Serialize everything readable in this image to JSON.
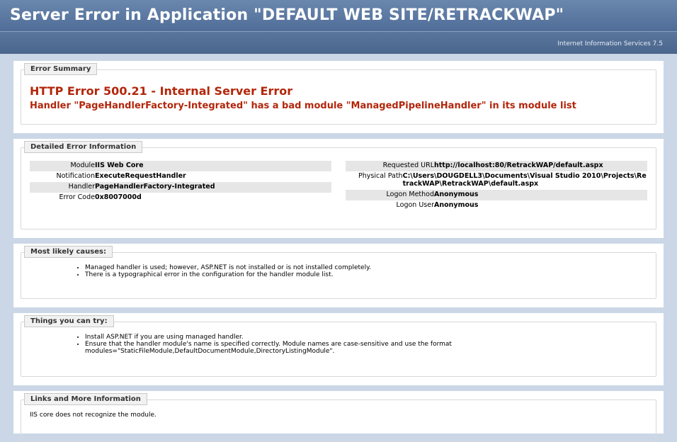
{
  "header": {
    "title": "Server Error in Application \"DEFAULT WEB SITE/RETRACKWAP\"",
    "server_name": "Internet Information Services 7.5"
  },
  "summary": {
    "legend": "Error Summary",
    "title": "HTTP Error 500.21 - Internal Server Error",
    "subtitle": "Handler \"PageHandlerFactory-Integrated\" has a bad module \"ManagedPipelineHandler\" in its module list"
  },
  "details": {
    "legend": "Detailed Error Information",
    "left": [
      {
        "label": "Module",
        "value": "IIS Web Core"
      },
      {
        "label": "Notification",
        "value": "ExecuteRequestHandler"
      },
      {
        "label": "Handler",
        "value": "PageHandlerFactory-Integrated"
      },
      {
        "label": "Error Code",
        "value": "0x8007000d"
      }
    ],
    "right": [
      {
        "label": "Requested URL",
        "value": "http://localhost:80/RetrackWAP/default.aspx"
      },
      {
        "label": "Physical Path",
        "value": "C:\\Users\\DOUGDELL3\\Documents\\Visual Studio 2010\\Projects\\RetrackWAP\\RetrackWAP\\default.aspx"
      },
      {
        "label": "Logon Method",
        "value": "Anonymous"
      },
      {
        "label": "Logon User",
        "value": "Anonymous"
      }
    ]
  },
  "causes": {
    "legend": "Most likely causes:",
    "items": [
      "Managed handler is used; however, ASP.NET is not installed or is not installed completely.",
      "There is a typographical error in the configuration for the handler module list."
    ]
  },
  "try": {
    "legend": "Things you can try:",
    "items": [
      "Install ASP.NET if you are using managed handler.",
      "Ensure that the handler module's name is specified correctly. Module names are case-sensitive and use the format modules=\"StaticFileModule,DefaultDocumentModule,DirectoryListingModule\"."
    ]
  },
  "links": {
    "legend": "Links and More Information",
    "text": "IIS core does not recognize the module."
  }
}
